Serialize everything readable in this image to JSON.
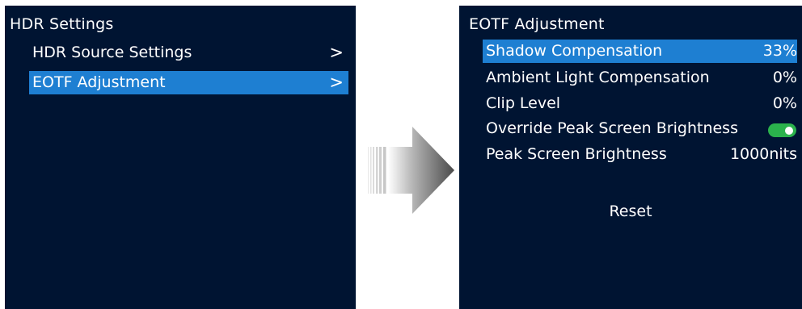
{
  "left_panel": {
    "title": "HDR Settings",
    "items": [
      {
        "label": "HDR Source Settings",
        "chevron": ">"
      },
      {
        "label": "EOTF Adjustment",
        "chevron": ">"
      }
    ],
    "selected_index": 1
  },
  "right_panel": {
    "title": "EOTF Adjustment",
    "rows": [
      {
        "label": "Shadow Compensation",
        "value": "33%"
      },
      {
        "label": "Ambient Light Compensation",
        "value": "0%"
      },
      {
        "label": "Clip Level",
        "value": "0%"
      },
      {
        "label": "Override Peak Screen Brightness",
        "toggle": "on"
      },
      {
        "label": "Peak Screen Brightness",
        "value": "1000nits"
      }
    ],
    "selected_index": 0,
    "reset_label": "Reset"
  },
  "icons": {
    "transition_arrow": "right-arrow-icon"
  },
  "colors": {
    "panel_background": "#001432",
    "selection": "#1e7fd2",
    "toggle_on": "#2bb24c",
    "text": "#ffffff"
  }
}
